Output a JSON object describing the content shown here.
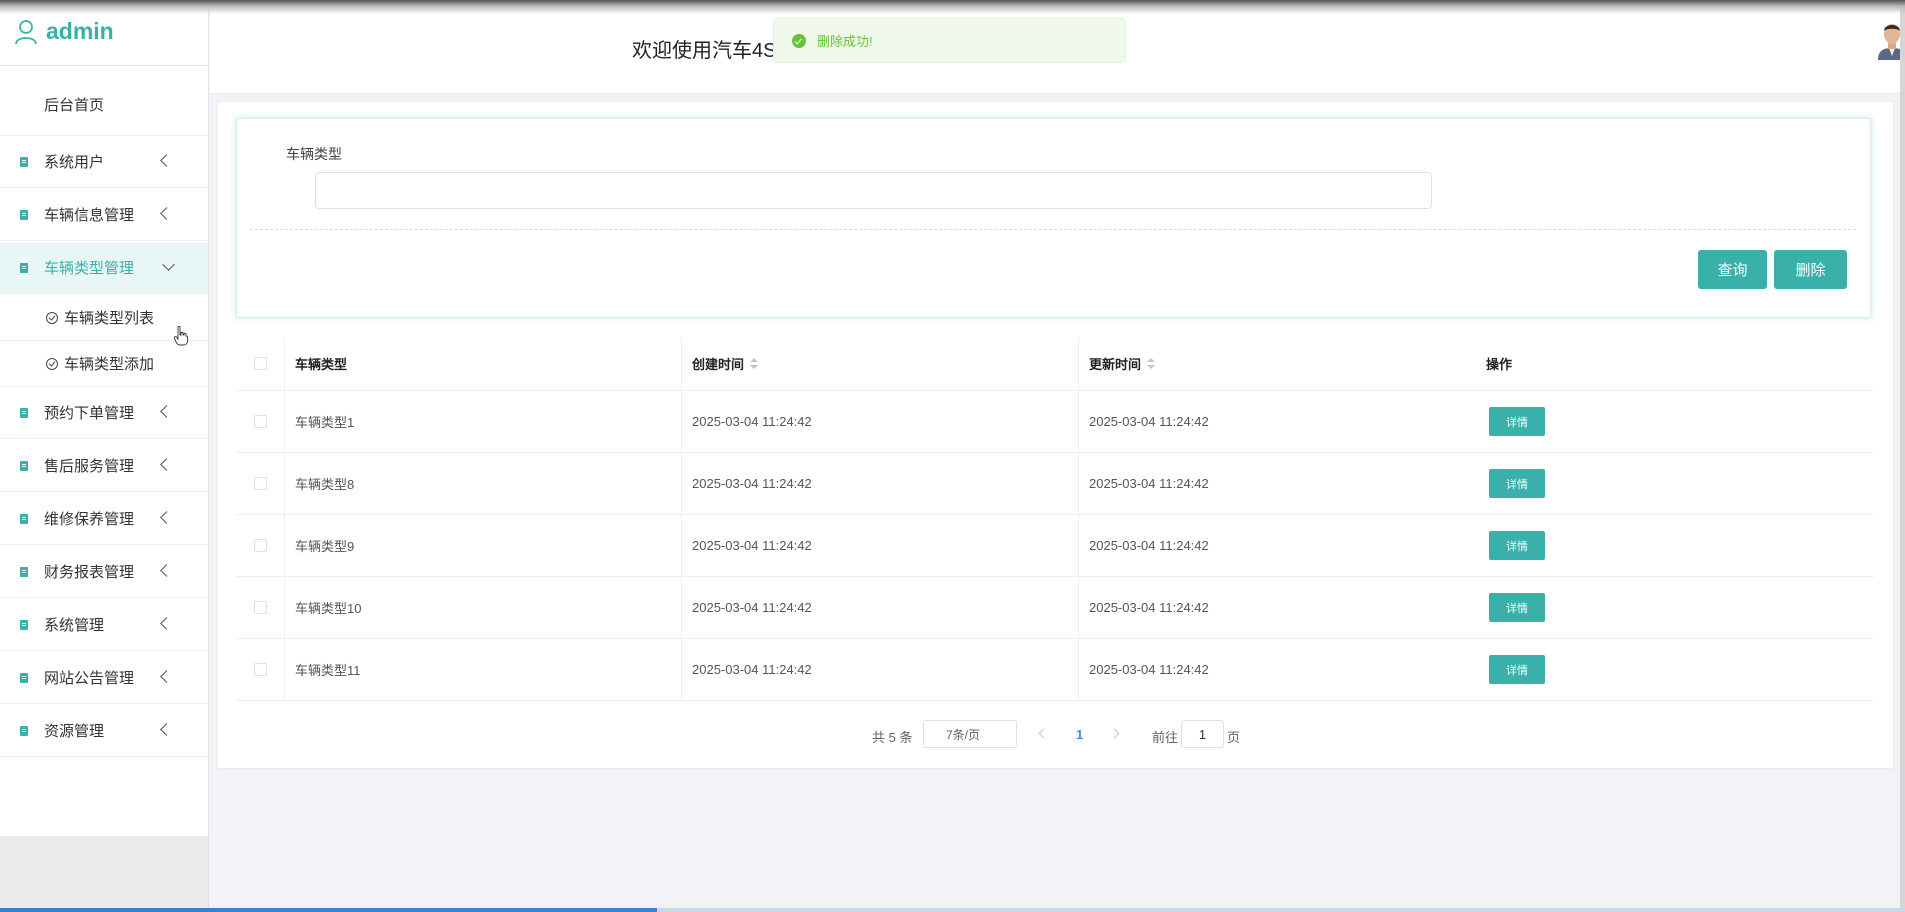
{
  "app": {
    "name": "admin",
    "header_title": "欢迎使用汽车4S"
  },
  "toast": {
    "message": "删除成功!"
  },
  "sidebar": {
    "home": "后台首页",
    "items": [
      {
        "label": "系统用户"
      },
      {
        "label": "车辆信息管理"
      },
      {
        "label": "车辆类型管理",
        "expanded": true
      },
      {
        "label": "预约下单管理"
      },
      {
        "label": "售后服务管理"
      },
      {
        "label": "维修保养管理"
      },
      {
        "label": "财务报表管理"
      },
      {
        "label": "系统管理"
      },
      {
        "label": "网站公告管理"
      },
      {
        "label": "资源管理"
      }
    ],
    "submenu": [
      {
        "label": "车辆类型列表"
      },
      {
        "label": "车辆类型添加"
      }
    ]
  },
  "search": {
    "label": "车辆类型",
    "value": "",
    "query_button": "查询",
    "delete_button": "删除"
  },
  "table": {
    "headers": {
      "type": "车辆类型",
      "created": "创建时间",
      "updated": "更新时间",
      "action": "操作"
    },
    "rows": [
      {
        "type": "车辆类型1",
        "created": "2025-03-04 11:24:42",
        "updated": "2025-03-04 11:24:42",
        "action": "详情"
      },
      {
        "type": "车辆类型8",
        "created": "2025-03-04 11:24:42",
        "updated": "2025-03-04 11:24:42",
        "action": "详情"
      },
      {
        "type": "车辆类型9",
        "created": "2025-03-04 11:24:42",
        "updated": "2025-03-04 11:24:42",
        "action": "详情"
      },
      {
        "type": "车辆类型10",
        "created": "2025-03-04 11:24:42",
        "updated": "2025-03-04 11:24:42",
        "action": "详情"
      },
      {
        "type": "车辆类型11",
        "created": "2025-03-04 11:24:42",
        "updated": "2025-03-04 11:24:42",
        "action": "详情"
      }
    ]
  },
  "pagination": {
    "total": "共 5 条",
    "page_size": "7条/页",
    "current_page": "1",
    "goto_label": "前往",
    "goto_value": "1",
    "page_unit": "页"
  },
  "colors": {
    "accent": "#3ab0aa",
    "toast_text": "#67c23a",
    "toast_bg": "#f0f9eb",
    "page_link": "#3a8ee6"
  },
  "progress": {
    "fraction": 0.345
  }
}
